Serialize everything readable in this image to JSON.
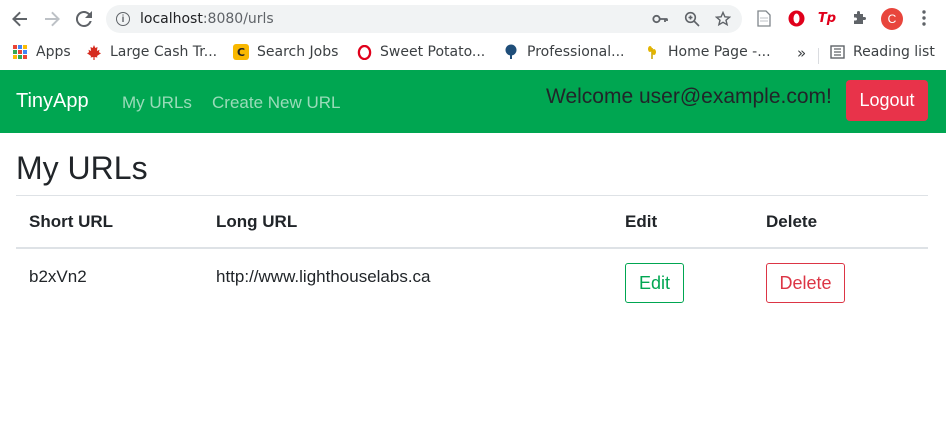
{
  "browser": {
    "url_host": "localhost",
    "url_rest": ":8080/urls",
    "avatar_letter": "C",
    "ext_tp_label": "Tp",
    "bookmarks": [
      {
        "label": "Apps"
      },
      {
        "label": "Large Cash Tr..."
      },
      {
        "label": "Search Jobs"
      },
      {
        "label": "Sweet Potato..."
      },
      {
        "label": "Professional..."
      },
      {
        "label": "Home Page -..."
      }
    ],
    "more_label": "»",
    "reading_list": "Reading list"
  },
  "navbar": {
    "brand": "TinyApp",
    "links": [
      "My URLs",
      "Create New URL"
    ],
    "welcome": "Welcome user@example.com!",
    "logout_label": "Logout"
  },
  "main": {
    "title": "My URLs",
    "columns": [
      "Short URL",
      "Long URL",
      "Edit",
      "Delete"
    ],
    "rows": [
      {
        "short_url": "b2xVn2",
        "long_url": "http://www.lighthouselabs.ca",
        "edit_label": "Edit",
        "delete_label": "Delete"
      }
    ]
  },
  "colors": {
    "navbar_bg": "#00a651",
    "logout_bg": "#e8334a",
    "edit_accent": "#00a651",
    "delete_accent": "#dc3545"
  },
  "icons": [
    "back-arrow-icon",
    "forward-arrow-icon",
    "reload-icon",
    "info-icon",
    "key-icon",
    "zoom-icon",
    "star-icon",
    "page-icon",
    "opera-icon",
    "tp-icon",
    "puzzle-icon",
    "menu-kebab-icon",
    "apps-grid-icon",
    "reading-list-icon"
  ]
}
